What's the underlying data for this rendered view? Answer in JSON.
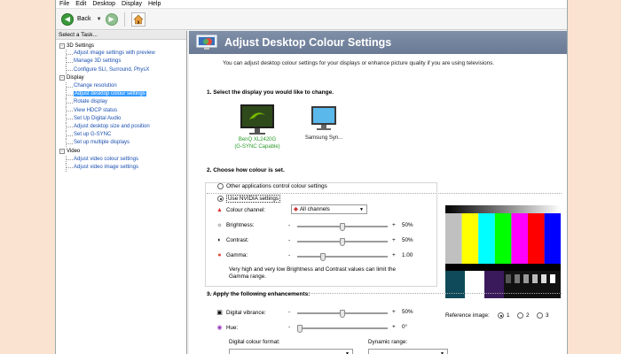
{
  "menu": [
    "File",
    "Edit",
    "Desktop",
    "Display",
    "Help"
  ],
  "toolbar": {
    "back_label": "Back"
  },
  "left_panel": {
    "heading": "Select a Task...",
    "categories": [
      {
        "label": "3D Settings",
        "items": [
          "Adjust image settings with preview",
          "Manage 3D settings",
          "Configure SLI, Surround, PhysX"
        ]
      },
      {
        "label": "Display",
        "items": [
          "Change resolution",
          "Adjust desktop colour settings",
          "Rotate display",
          "View HDCP status",
          "Set Up Digital Audio",
          "Adjust desktop size and position",
          "Set up G-SYNC",
          "Set up multiple displays"
        ]
      },
      {
        "label": "Video",
        "items": [
          "Adjust video colour settings",
          "Adjust video image settings"
        ]
      }
    ],
    "selected_item": "Adjust desktop colour settings"
  },
  "page": {
    "title": "Adjust Desktop Colour Settings",
    "description": "You can adjust desktop colour settings for your displays or enhance picture quality if you are using televisions."
  },
  "section1": {
    "title": "1. Select the display you would like to change.",
    "displays": [
      {
        "name_line1": "BenQ XL2420G",
        "name_line2": "(G-SYNC Capable)",
        "selected": true
      },
      {
        "name_line1": "Samsung Syn...",
        "name_line2": "",
        "selected": false
      }
    ]
  },
  "section2": {
    "title": "2. Choose how colour is set.",
    "option_other": "Other applications control colour settings",
    "option_nvidia": "Use NVIDIA settings",
    "selected_option": "Use NVIDIA settings",
    "colour_channel_label": "Colour channel:",
    "colour_channel_value": "All channels",
    "brightness_label": "Brightness:",
    "brightness_value": "50%",
    "brightness_level": 0.5,
    "contrast_label": "Contrast:",
    "contrast_value": "50%",
    "contrast_level": 0.5,
    "gamma_label": "Gamma:",
    "gamma_value": "1.00",
    "gamma_level": 0.27,
    "note": "Very high and very low Brightness and Contrast values can limit the Gamma range."
  },
  "section3": {
    "title": "3. Apply the following enhancements:",
    "vibrance_label": "Digital vibrance:",
    "vibrance_value": "50%",
    "vibrance_level": 0.5,
    "hue_label": "Hue:",
    "hue_value": "0°",
    "hue_level": 0.0
  },
  "reference": {
    "label": "Reference image:",
    "options": [
      "1",
      "2",
      "3"
    ],
    "selected": "1"
  },
  "bottom": {
    "digital_colour_format_label": "Digital colour format:",
    "dynamic_range_label": "Dynamic range:"
  },
  "slider_symbols": {
    "minus": "-",
    "plus": "+"
  },
  "colors": {
    "header_bg": "#7282a0",
    "selection": "#3399ff",
    "link_blue": "#1a4fb0",
    "gsync_green": "#2b9a2b"
  }
}
